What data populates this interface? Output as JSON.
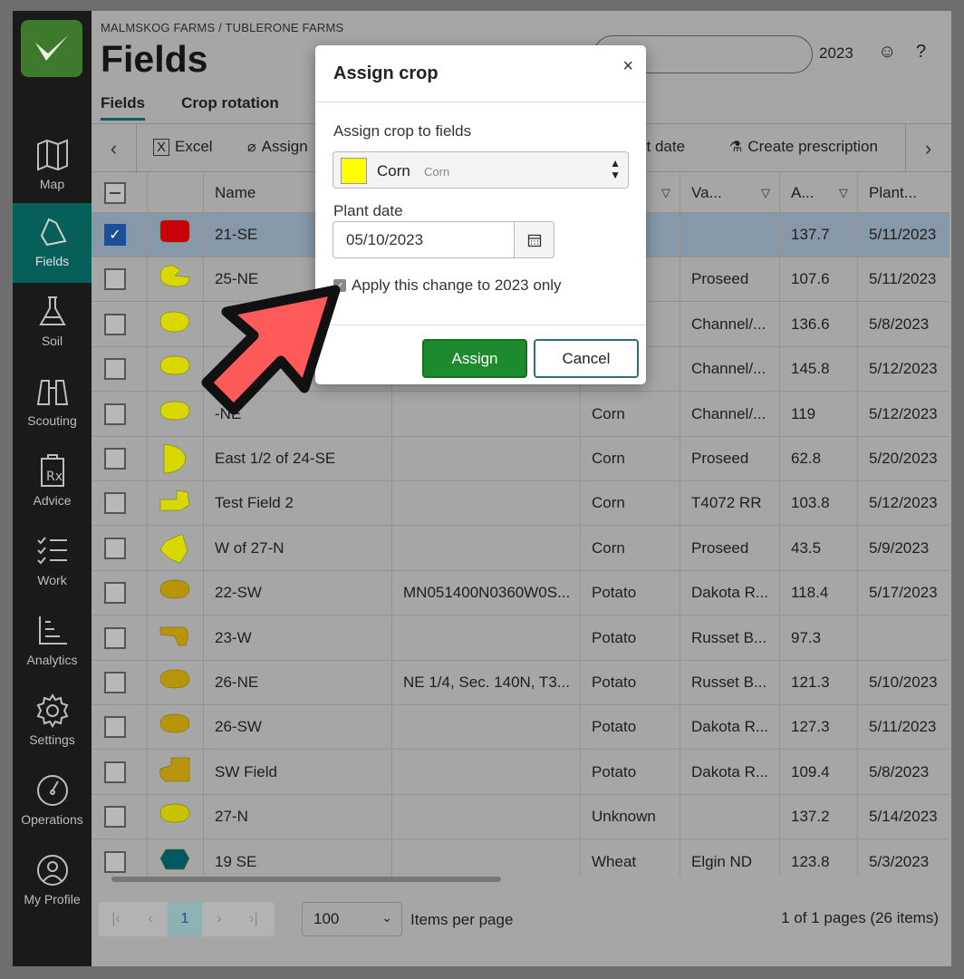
{
  "nav": [
    {
      "label": "Map",
      "icon": "map-icon"
    },
    {
      "label": "Fields",
      "icon": "fields-icon"
    },
    {
      "label": "Soil",
      "icon": "flask-icon"
    },
    {
      "label": "Scouting",
      "icon": "binoculars-icon"
    },
    {
      "label": "Advice",
      "icon": "prescription-icon"
    },
    {
      "label": "Work",
      "icon": "checklist-icon"
    },
    {
      "label": "Analytics",
      "icon": "chart-icon"
    },
    {
      "label": "Settings",
      "icon": "gear-icon"
    },
    {
      "label": "Operations",
      "icon": "gauge-icon"
    },
    {
      "label": "My Profile",
      "icon": "user-icon"
    }
  ],
  "header": {
    "breadcrumb": "MALMSKOG FARMS / TUBLERONE FARMS",
    "title": "Fields",
    "tabs": [
      "Fields",
      "Crop rotation"
    ],
    "search_fragment": "h",
    "year": "2023"
  },
  "toolbar": {
    "excel": "Excel",
    "assign": "Assign",
    "plant_date_fragment": "st date",
    "create_prescription": "Create prescription"
  },
  "table": {
    "headers": [
      "Name",
      "Va...",
      "A...",
      "Plant..."
    ],
    "rows": [
      {
        "name": "21-SE",
        "desc": "",
        "crop": "",
        "variety": "",
        "area": "137.7",
        "plant": "5/11/2023",
        "color": "#c8000a",
        "checked": true
      },
      {
        "name": "25-NE",
        "desc": "",
        "crop": "",
        "variety": "Proseed",
        "area": "107.6",
        "plant": "5/11/2023",
        "color": "#d8d800",
        "checked": false
      },
      {
        "name": "",
        "desc": "",
        "crop": "",
        "variety": "Channel/...",
        "area": "136.6",
        "plant": "5/8/2023",
        "color": "#d8d800",
        "checked": false
      },
      {
        "name": "",
        "desc": "",
        "crop": "",
        "variety": "Channel/...",
        "area": "145.8",
        "plant": "5/12/2023",
        "color": "#d8d800",
        "checked": false
      },
      {
        "name": "-NE",
        "desc": "",
        "crop": "Corn",
        "variety": "Channel/...",
        "area": "119",
        "plant": "5/12/2023",
        "color": "#d8d800",
        "checked": false
      },
      {
        "name": "East 1/2 of 24-SE",
        "desc": "",
        "crop": "Corn",
        "variety": "Proseed",
        "area": "62.8",
        "plant": "5/20/2023",
        "color": "#d8d800",
        "checked": false
      },
      {
        "name": "Test Field 2",
        "desc": "",
        "crop": "Corn",
        "variety": "T4072 RR",
        "area": "103.8",
        "plant": "5/12/2023",
        "color": "#d8d800",
        "checked": false
      },
      {
        "name": "W of 27-N",
        "desc": "",
        "crop": "Corn",
        "variety": "Proseed",
        "area": "43.5",
        "plant": "5/9/2023",
        "color": "#d8d800",
        "checked": false
      },
      {
        "name": "22-SW",
        "desc": "MN051400N0360W0S...",
        "crop": "Potato",
        "variety": "Dakota R...",
        "area": "118.4",
        "plant": "5/17/2023",
        "color": "#b8940a",
        "checked": false
      },
      {
        "name": "23-W",
        "desc": "",
        "crop": "Potato",
        "variety": "Russet B...",
        "area": "97.3",
        "plant": "",
        "color": "#b8940a",
        "checked": false
      },
      {
        "name": "26-NE",
        "desc": "NE 1/4, Sec. 140N, T3...",
        "crop": "Potato",
        "variety": "Russet B...",
        "area": "121.3",
        "plant": "5/10/2023",
        "color": "#b8940a",
        "checked": false
      },
      {
        "name": "26-SW",
        "desc": "",
        "crop": "Potato",
        "variety": "Dakota R...",
        "area": "127.3",
        "plant": "5/11/2023",
        "color": "#b8940a",
        "checked": false
      },
      {
        "name": "SW Field",
        "desc": "",
        "crop": "Potato",
        "variety": "Dakota R...",
        "area": "109.4",
        "plant": "5/8/2023",
        "color": "#b8940a",
        "checked": false
      },
      {
        "name": "27-N",
        "desc": "",
        "crop": "Unknown",
        "variety": "",
        "area": "137.2",
        "plant": "5/14/2023",
        "color": "#c8c200",
        "checked": false
      },
      {
        "name": "19 SE",
        "desc": "",
        "crop": "Wheat",
        "variety": "Elgin ND",
        "area": "123.8",
        "plant": "5/3/2023",
        "color": "#005860",
        "checked": false
      }
    ]
  },
  "pager": {
    "current": "1",
    "per_page": "100",
    "per_page_label": "Items per page",
    "summary": "1 of 1 pages (26 items)"
  },
  "modal": {
    "title": "Assign crop",
    "close": "×",
    "crop_label": "Assign crop to fields",
    "crop_value": "Corn",
    "crop_sub": "Corn",
    "crop_color": "#ffff00",
    "date_label": "Plant date",
    "date_value": "05/10/2023",
    "apply_label": "Apply this change to 2023 only",
    "assign": "Assign",
    "cancel": "Cancel"
  }
}
